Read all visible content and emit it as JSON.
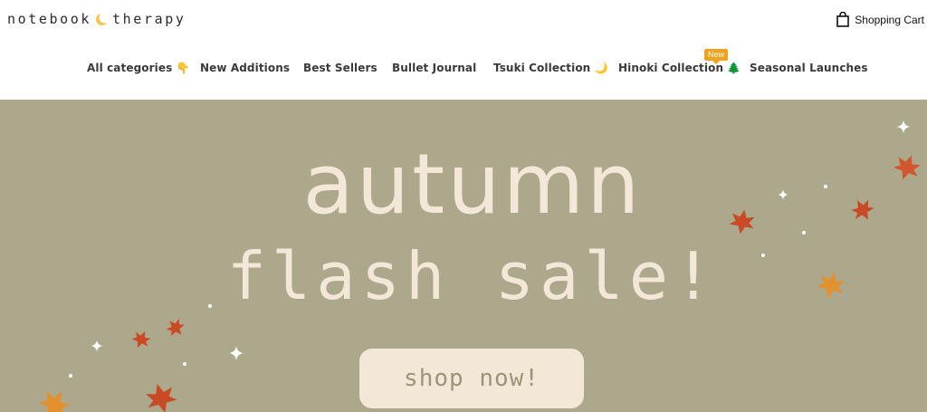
{
  "header": {
    "logo_left": "notebook",
    "logo_right": "therapy",
    "cart_label": "Shopping Cart"
  },
  "nav": {
    "items": [
      {
        "label": "All categories 👇"
      },
      {
        "label": "New Additions"
      },
      {
        "label": "Best Sellers"
      },
      {
        "label": "Bullet Journal"
      },
      {
        "label": "Tsuki Collection 🌙"
      },
      {
        "label": "Hinoki Collection 🌲"
      },
      {
        "label": "Seasonal Launches"
      }
    ],
    "badge": "New"
  },
  "hero": {
    "headline_line1": "autumn",
    "headline_line2": "flash sale!",
    "cta_label": "shop now!",
    "bg_color": "#aca88b",
    "text_color": "#f3e7d7"
  },
  "icons": {
    "moon": "crescent-moon-icon",
    "cart": "shopping-bag-icon",
    "leaf": "maple-leaf-icon",
    "sparkle": "sparkle-icon"
  }
}
